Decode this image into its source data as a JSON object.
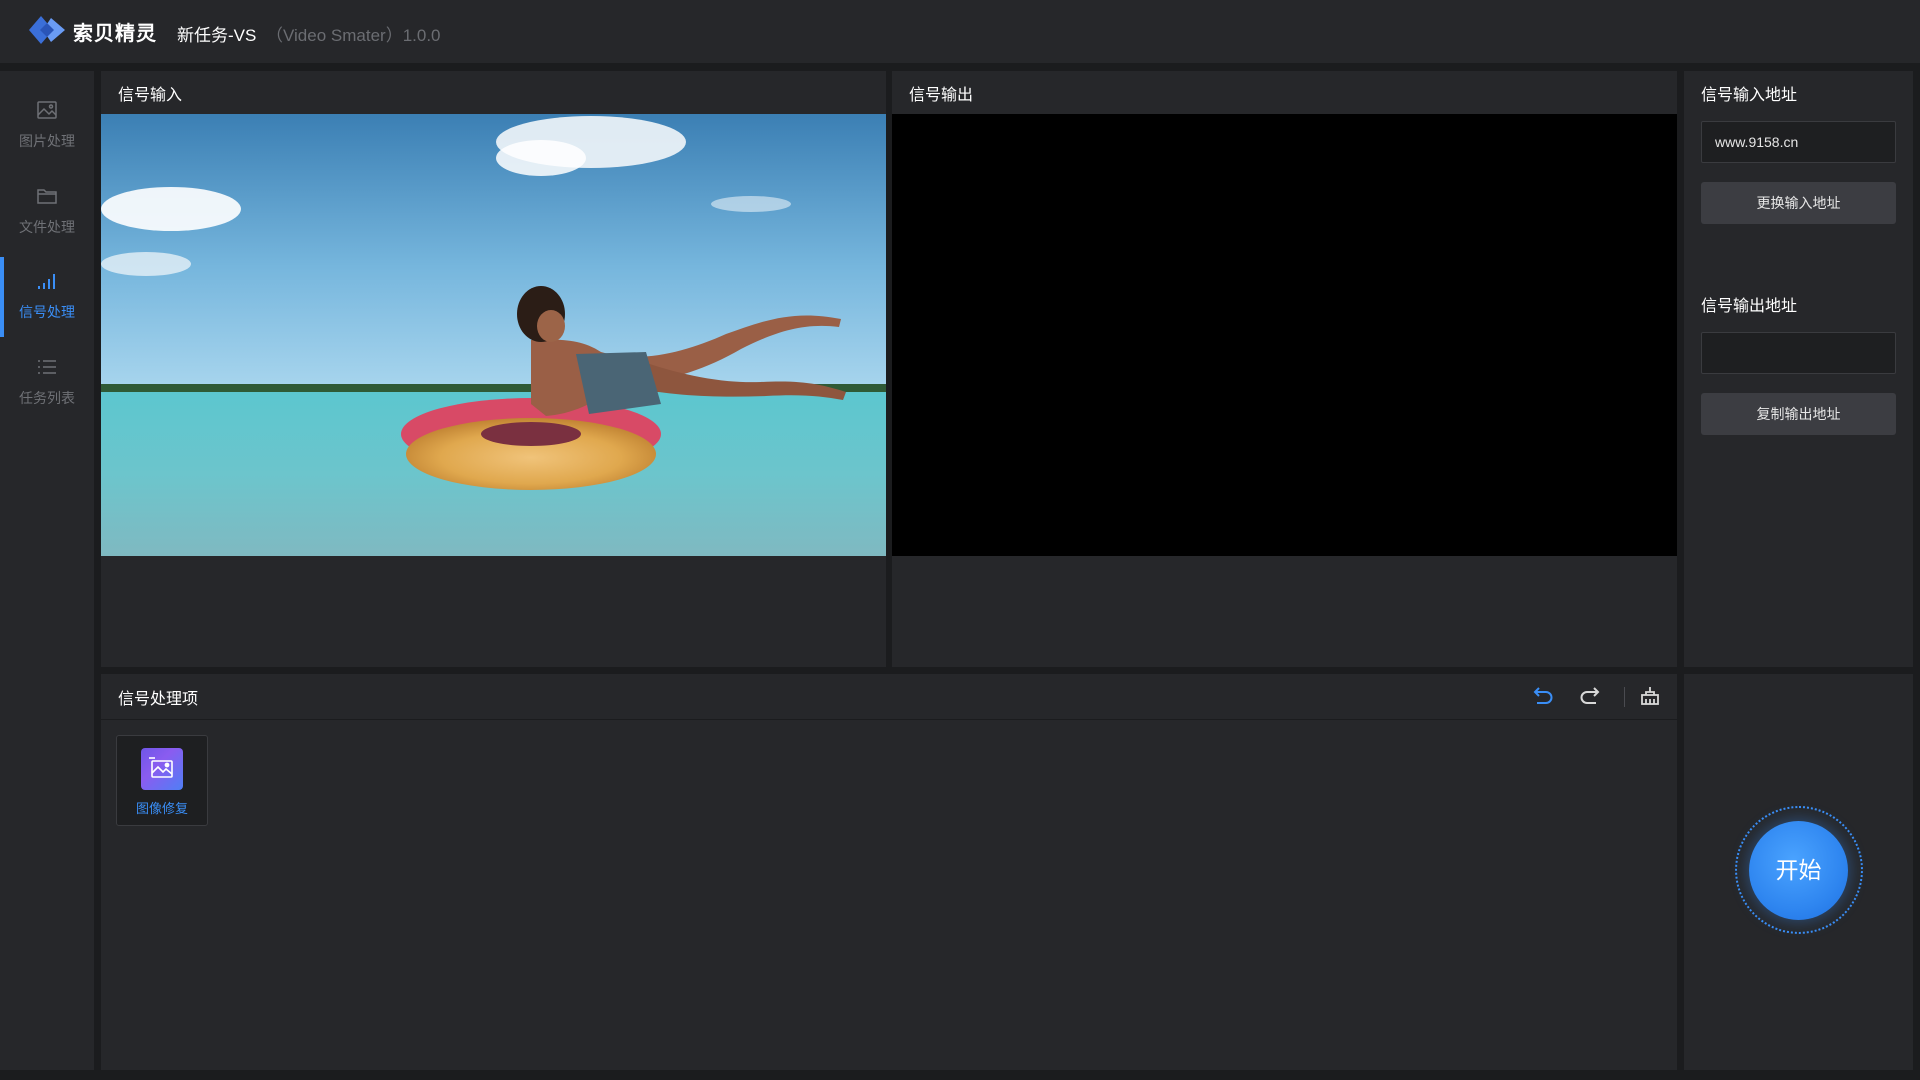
{
  "header": {
    "brand": "索贝精灵",
    "task_name": "新任务-VS",
    "app_version": "（Video Smater）1.0.0"
  },
  "sidebar": {
    "items": [
      {
        "label": "图片处理",
        "icon": "image-icon",
        "active": false
      },
      {
        "label": "文件处理",
        "icon": "folder-icon",
        "active": false
      },
      {
        "label": "信号处理",
        "icon": "signal-bars-icon",
        "active": true
      },
      {
        "label": "任务列表",
        "icon": "list-icon",
        "active": false
      }
    ]
  },
  "signal_input": {
    "title": "信号输入"
  },
  "signal_output": {
    "title": "信号输出"
  },
  "address": {
    "input_title": "信号输入地址",
    "input_value": "www.9158.cn",
    "change_input_button": "更换输入地址",
    "output_title": "信号输出地址",
    "output_value": "",
    "copy_output_button": "复制输出地址"
  },
  "processing": {
    "title": "信号处理项",
    "toolbar_icons": [
      "undo-icon",
      "redo-icon",
      "clear-icon"
    ],
    "items": [
      {
        "label": "图像修复",
        "icon": "image-repair-icon"
      }
    ]
  },
  "start": {
    "label": "开始"
  },
  "colors": {
    "accent": "#3a8ef6",
    "background": "#1b1c1e",
    "panel": "#26272a"
  }
}
